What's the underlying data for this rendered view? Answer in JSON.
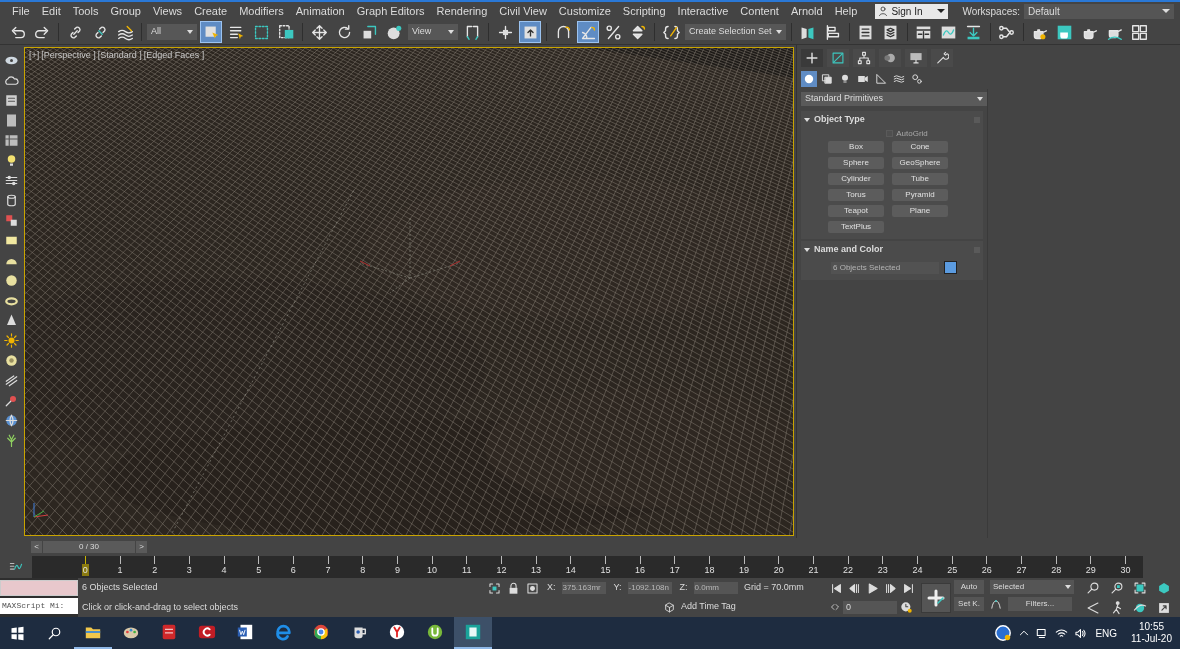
{
  "menu": [
    "File",
    "Edit",
    "Tools",
    "Group",
    "Views",
    "Create",
    "Modifiers",
    "Animation",
    "Graph Editors",
    "Rendering",
    "Civil View",
    "Customize",
    "Scripting",
    "Interactive",
    "Content",
    "Arnold",
    "Help"
  ],
  "account": {
    "label": "Sign In"
  },
  "workspaces": {
    "label": "Workspaces:",
    "value": "Default"
  },
  "toolbar": [
    {
      "kind": "tool",
      "selected": false
    },
    {
      "kind": "tool",
      "selected": false
    },
    {
      "kind": "separator"
    },
    {
      "kind": "tool",
      "selected": false
    },
    {
      "kind": "tool",
      "selected": false
    },
    {
      "kind": "tool",
      "selected": false
    },
    {
      "kind": "separator"
    },
    {
      "kind": "dropdown",
      "value": "All"
    },
    {
      "kind": "tool",
      "selected": true
    },
    {
      "kind": "tool",
      "selected": false
    },
    {
      "kind": "tool",
      "selected": false
    },
    {
      "kind": "tool",
      "selected": false
    },
    {
      "kind": "separator"
    },
    {
      "kind": "tool",
      "selected": false
    },
    {
      "kind": "tool",
      "selected": false
    },
    {
      "kind": "tool",
      "selected": false
    },
    {
      "kind": "tool",
      "selected": false
    },
    {
      "kind": "dropdown",
      "value": "View"
    },
    {
      "kind": "tool",
      "selected": false
    },
    {
      "kind": "separator"
    },
    {
      "kind": "tool",
      "selected": false
    },
    {
      "kind": "tool",
      "selected": true
    },
    {
      "kind": "separator"
    },
    {
      "kind": "tool",
      "selected": false
    },
    {
      "kind": "tool",
      "selected": true
    },
    {
      "kind": "tool",
      "selected": false
    },
    {
      "kind": "tool",
      "selected": false
    },
    {
      "kind": "separator"
    },
    {
      "kind": "tool",
      "selected": false
    },
    {
      "kind": "dropdown",
      "value": "Create Selection Set"
    },
    {
      "kind": "separator"
    },
    {
      "kind": "tool",
      "selected": false
    },
    {
      "kind": "tool",
      "selected": false
    },
    {
      "kind": "separator"
    },
    {
      "kind": "tool",
      "selected": false
    },
    {
      "kind": "tool",
      "selected": false
    },
    {
      "kind": "separator"
    },
    {
      "kind": "tool",
      "selected": false
    },
    {
      "kind": "tool",
      "selected": false
    },
    {
      "kind": "tool",
      "selected": false
    },
    {
      "kind": "separator"
    },
    {
      "kind": "tool",
      "selected": false
    },
    {
      "kind": "separator"
    },
    {
      "kind": "tool",
      "selected": false
    },
    {
      "kind": "tool",
      "selected": false
    },
    {
      "kind": "tool",
      "selected": false
    },
    {
      "kind": "tool",
      "selected": false
    },
    {
      "kind": "tool",
      "selected": false
    }
  ],
  "viewport": {
    "labels": [
      "[+]",
      "[Perspective ]",
      "[Standard ]",
      "[Edged Faces ]"
    ],
    "active": true
  },
  "command_panel": {
    "tabs": [
      {
        "selected": true
      },
      {
        "selected": false
      },
      {
        "selected": false
      },
      {
        "selected": false
      },
      {
        "selected": false
      },
      {
        "selected": false
      }
    ],
    "categories": [
      {
        "selected": true
      },
      {
        "selected": false
      },
      {
        "selected": false
      },
      {
        "selected": false
      },
      {
        "selected": false
      },
      {
        "selected": false
      },
      {
        "selected": false
      }
    ],
    "dropdown": "Standard Primitives",
    "object_type": {
      "title": "Object Type",
      "expanded": true,
      "autogrid": {
        "label": "AutoGrid",
        "checked": false,
        "disabled": true
      },
      "buttons": [
        "Box",
        "Cone",
        "Sphere",
        "GeoSphere",
        "Cylinder",
        "Tube",
        "Torus",
        "Pyramid",
        "Teapot",
        "Plane",
        "TextPlus"
      ]
    },
    "name_and_color": {
      "title": "Name and Color",
      "expanded": true,
      "name": "6 Objects Selected",
      "color": "#5b9be0"
    }
  },
  "time_slider": {
    "prev": "<",
    "value": "0 / 30",
    "next": ">",
    "level": 0
  },
  "track_bar": {
    "ticks": [
      "0",
      "1",
      "2",
      "3",
      "4",
      "5",
      "6",
      "7",
      "8",
      "9",
      "10",
      "11",
      "12",
      "13",
      "14",
      "15",
      "16",
      "17",
      "18",
      "19",
      "20",
      "21",
      "22",
      "23",
      "24",
      "25",
      "26",
      "27",
      "28",
      "29",
      "30"
    ]
  },
  "status": {
    "listener": "MAXScript Mi:",
    "selection": "6 Objects Selected",
    "prompt": "Click or click-and-drag to select objects",
    "coords": [
      {
        "label": "X:",
        "value": "375.163mr"
      },
      {
        "label": "Y:",
        "value": "-1092.108n"
      },
      {
        "label": "Z:",
        "value": "0.0mm"
      }
    ],
    "grid": "Grid = 70.0mm",
    "time_tag": "Add Time Tag",
    "frame": "0",
    "auto": "Auto",
    "key_filter": "Selected",
    "set_key": "Set K.",
    "filters": "Filters..."
  },
  "taskbar": {
    "apps": [
      {
        "running": true,
        "selected": false
      },
      {
        "running": false,
        "selected": false
      },
      {
        "running": false,
        "selected": false
      },
      {
        "running": false,
        "selected": false
      },
      {
        "running": false,
        "selected": false
      },
      {
        "running": false,
        "selected": false
      },
      {
        "running": false,
        "selected": false
      },
      {
        "running": false,
        "selected": false
      },
      {
        "running": false,
        "selected": false
      },
      {
        "running": false,
        "selected": false
      },
      {
        "running": true,
        "selected": true
      }
    ],
    "language": "ENG",
    "time": "10:55",
    "date": "11-Jul-20"
  }
}
